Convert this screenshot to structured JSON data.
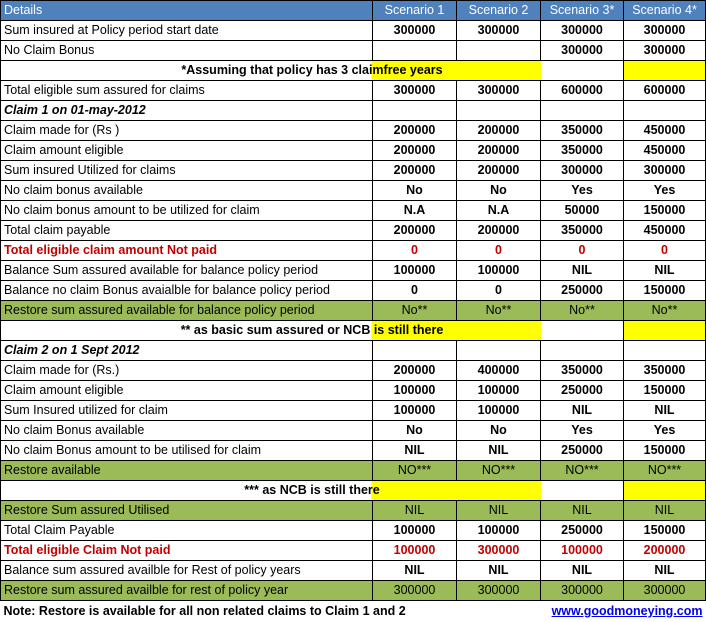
{
  "header": [
    "Details",
    "Scenario 1",
    "Scenario 2",
    "Scenario 3*",
    "Scenario 4*"
  ],
  "rows_top": [
    {
      "label": "Sum insured at Policy period start date",
      "values": [
        "300000",
        "300000",
        "300000",
        "300000"
      ],
      "style": "bold"
    },
    {
      "label": "No Claim Bonus",
      "values": [
        "",
        "",
        "300000",
        "300000"
      ],
      "style": "bold"
    }
  ],
  "note1": "*Assuming that policy has 3 claimfree years",
  "row_total_eligible": {
    "label": "Total eligible sum assured for claims",
    "values": [
      "300000",
      "300000",
      "600000",
      "600000"
    ]
  },
  "claim1_title": "Claim 1 on 01-may-2012",
  "claim1_rows": [
    {
      "label": "Claim made for (Rs )",
      "values": [
        "200000",
        "200000",
        "350000",
        "450000"
      ],
      "style": "plain"
    },
    {
      "label": "Claim amount eligible",
      "values": [
        "200000",
        "200000",
        "350000",
        "450000"
      ],
      "style": "plain"
    },
    {
      "label": "Sum insured Utilized for claims",
      "values": [
        "200000",
        "200000",
        "300000",
        "300000"
      ],
      "style": "plain"
    },
    {
      "label": "No claim bonus available",
      "values": [
        "No",
        "No",
        "Yes",
        "Yes"
      ],
      "style": "plain"
    },
    {
      "label": "No claim bonus amount to be utilized for claim",
      "values": [
        "N.A",
        "N.A",
        "50000",
        "150000"
      ],
      "style": "plain"
    },
    {
      "label": "Total claim payable",
      "values": [
        "200000",
        "200000",
        "350000",
        "450000"
      ],
      "style": "plain"
    },
    {
      "label": "Total eligible claim amount Not paid",
      "values": [
        "0",
        "0",
        "0",
        "0"
      ],
      "style": "red"
    },
    {
      "label": "Balance Sum assured available for balance policy period",
      "values": [
        "100000",
        "100000",
        "NIL",
        "NIL"
      ],
      "style": "plain"
    },
    {
      "label": "Balance no claim Bonus avaialble for balance policy period",
      "values": [
        "0",
        "0",
        "250000",
        "150000"
      ],
      "style": "plain"
    },
    {
      "label": "Restore sum assured available for balance policy period",
      "values": [
        "No**",
        "No**",
        "No**",
        "No**"
      ],
      "style": "green"
    }
  ],
  "note2": "** as basic sum assured or NCB is still there",
  "claim2_title": "Claim 2 on 1 Sept 2012",
  "claim2_rows": [
    {
      "label": "Claim made for (Rs.)",
      "values": [
        "200000",
        "400000",
        "350000",
        "350000"
      ],
      "style": "plain"
    },
    {
      "label": "Claim amount eligible",
      "values": [
        "100000",
        "100000",
        "250000",
        "150000"
      ],
      "style": "plain"
    },
    {
      "label": "Sum Insured utilized for claim",
      "values": [
        "100000",
        "100000",
        "NIL",
        "NIL"
      ],
      "style": "plain"
    },
    {
      "label": "No claim Bonus available",
      "values": [
        "No",
        "No",
        "Yes",
        "Yes"
      ],
      "style": "plain"
    },
    {
      "label": "No claim Bonus amount to be utilised for claim",
      "values": [
        "NIL",
        "NIL",
        "250000",
        "150000"
      ],
      "style": "plain"
    },
    {
      "label": "Restore available",
      "values": [
        "NO***",
        "NO***",
        "NO***",
        "NO***"
      ],
      "style": "green"
    }
  ],
  "note3": "*** as NCB is still there",
  "bottom_rows": [
    {
      "label": "Restore Sum assured Utilised",
      "values": [
        "NIL",
        "NIL",
        "NIL",
        "NIL"
      ],
      "style": "green"
    },
    {
      "label": "Total Claim Payable",
      "values": [
        "100000",
        "100000",
        "250000",
        "150000"
      ],
      "style": "plain"
    },
    {
      "label": "Total eligible Claim Not paid",
      "values": [
        "100000",
        "300000",
        "100000",
        "200000"
      ],
      "style": "red"
    },
    {
      "label": "Balance sum assured availble for Rest of policy years",
      "values": [
        "NIL",
        "NIL",
        "NIL",
        "NIL"
      ],
      "style": "plain"
    },
    {
      "label": "Restore sum assured availble for rest of policy year",
      "values": [
        "300000",
        "300000",
        "300000",
        "300000"
      ],
      "style": "green"
    }
  ],
  "footer": {
    "note": "Note: Restore is available for all non related claims to Claim 1 and 2",
    "link": "www.goodmoneying.com"
  },
  "colors": {
    "header_bg": "#4f81bd",
    "green_bg": "#9bbb59",
    "highlight": "#ffff00",
    "red_text": "#c00000"
  }
}
